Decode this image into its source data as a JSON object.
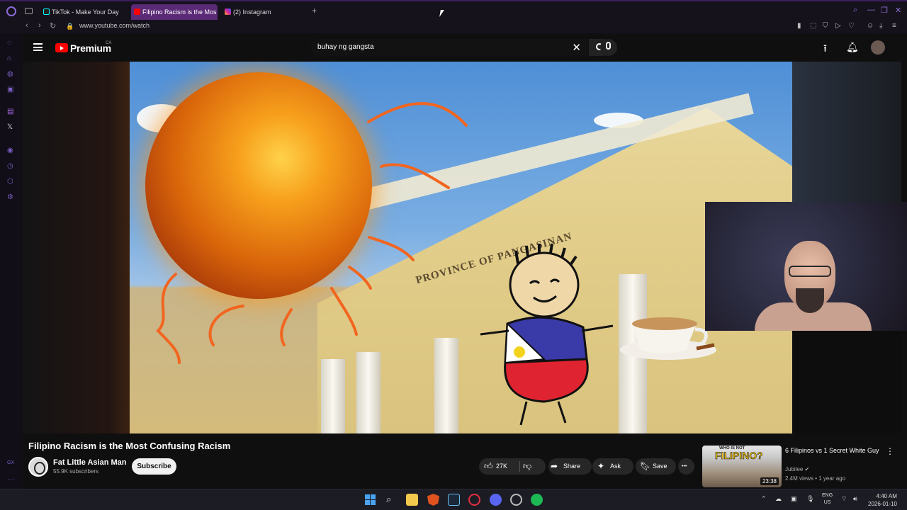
{
  "browser": {
    "tabs": [
      {
        "label": "TikTok - Make Your Day",
        "active": false,
        "icon": "tiktok-icon"
      },
      {
        "label": "Filipino Racism is the Mos",
        "active": true,
        "icon": "youtube-icon"
      },
      {
        "label": "(2) Instagram",
        "active": false,
        "icon": "instagram-icon"
      }
    ],
    "new_tab": "+",
    "url": "www.youtube.com/watch",
    "accent": "#5b2a77"
  },
  "youtube": {
    "logo_text": "Premium",
    "country": "CA",
    "search_value": "buhay ng gangsta",
    "clear_glyph": "✕",
    "brand_color": "#ff0000"
  },
  "video": {
    "thumbnail_banner": "PROVINCE OF PANGASINAN",
    "title": "Filipino Racism is the Most Confusing Racism",
    "channel": "Fat Little Asian Man",
    "subscribers": "55.9K subscribers",
    "subscribe_label": "Subscribe",
    "likes": "27K",
    "share_label": "Share",
    "ask_label": "Ask",
    "save_label": "Save",
    "more_glyph": "•••"
  },
  "recommendation": {
    "thumb_top": "WHO IS NOT",
    "thumb_main": "FILIPINO?",
    "duration": "23:38",
    "title": "6 Filipinos vs 1 Secret White Guy",
    "channel": "Jubilee",
    "meta": "2.4M views • 1 year ago"
  },
  "taskbar": {
    "lang_line1": "ENG",
    "lang_line2": "US",
    "time": "4:40 AM",
    "date": "2026-01-10"
  }
}
